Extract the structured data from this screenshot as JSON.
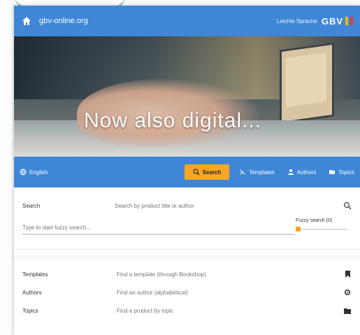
{
  "header": {
    "site_name": "gbv-online.org",
    "header_link": "Leichte Sprache",
    "logo_text": "GBV"
  },
  "hero": {
    "headline": "Now also digital..."
  },
  "nav": {
    "language": "English",
    "search": "Search",
    "templates": "Templates",
    "authors": "Authors",
    "topics": "Topics"
  },
  "search": {
    "label": "Search",
    "placeholder": "Search by product title or author",
    "fuzzy_placeholder": "Type to start fuzzy search...",
    "fuzzy_label": "Fuzzy search (0)",
    "fuzzy_value": 0
  },
  "filters": [
    {
      "label": "Templates",
      "value": "Find a template (through Bookshop)"
    },
    {
      "label": "Authors",
      "value": "Find an author (alphabetical)"
    },
    {
      "label": "Topics",
      "value": "Find a product by topic"
    }
  ],
  "colors": {
    "header": "#3f87d6",
    "accent": "#f6a623"
  },
  "icons": {
    "home": "home-icon",
    "language": "globe-icon",
    "search": "search-icon",
    "templates": "template-icon",
    "authors": "person-icon",
    "topics": "folder-icon",
    "filter_templates": "bookmark-icon",
    "filter_authors": "gear-icon",
    "filter_topics": "folder-icon"
  }
}
